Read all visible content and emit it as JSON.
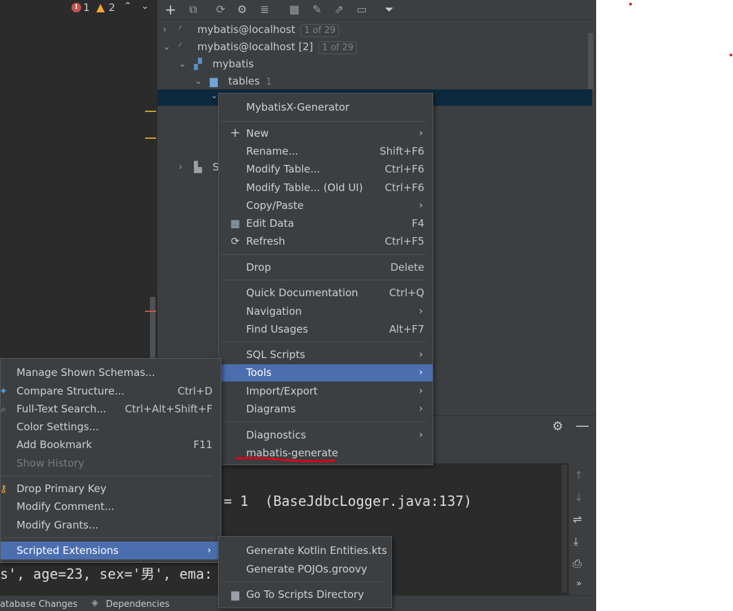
{
  "status": {
    "errors": "1",
    "warnings": "2"
  },
  "tree": {
    "ds1": {
      "label": "mybatis@localhost",
      "badge": "1 of 29"
    },
    "ds2": {
      "label": "mybatis@localhost [2]",
      "badge": "1 of 29"
    },
    "schema": {
      "label": "mybatis"
    },
    "tables": {
      "label": "tables",
      "count": "1"
    },
    "server_label": "S"
  },
  "context_menu": {
    "items": {
      "generator": "MybatisX-Generator",
      "new": "New",
      "rename": "Rename...",
      "rename_sc": "Shift+F6",
      "modify": "Modify Table...",
      "modify_sc": "Ctrl+F6",
      "modify_old": "Modify Table... (Old UI)",
      "modify_old_sc": "Ctrl+F6",
      "copy_paste": "Copy/Paste",
      "edit_data": "Edit Data",
      "edit_data_sc": "F4",
      "refresh": "Refresh",
      "refresh_sc": "Ctrl+F5",
      "drop": "Drop",
      "drop_sc": "Delete",
      "quick_doc": "Quick Documentation",
      "quick_doc_sc": "Ctrl+Q",
      "navigation": "Navigation",
      "find_usages": "Find Usages",
      "find_usages_sc": "Alt+F7",
      "sql_scripts": "SQL Scripts",
      "tools": "Tools",
      "import_export": "Import/Export",
      "diagrams": "Diagrams",
      "diagnostics": "Diagnostics",
      "mabatis": "mabatis-generate"
    }
  },
  "left_menu": {
    "items": {
      "manage_schemas": "Manage Shown Schemas...",
      "compare": "Compare Structure...",
      "compare_sc": "Ctrl+D",
      "full_text": "Full-Text Search...",
      "full_text_sc": "Ctrl+Alt+Shift+F",
      "color": "Color Settings...",
      "bookmark": "Add Bookmark",
      "bookmark_sc": "F11",
      "history": "Show History",
      "drop_pk": "Drop Primary Key",
      "modify_comment": "Modify Comment...",
      "modify_grants": "Modify Grants...",
      "scripted": "Scripted Extensions"
    }
  },
  "scripts_menu": {
    "items": {
      "kotlin": "Generate Kotlin Entities.kts",
      "pojos": "Generate POJOs.groovy",
      "go_dir": "Go To Scripts Directory"
    }
  },
  "console": {
    "line1": "d = 1  (BaseJdbcLogger.java:137)",
    "line2": "s', age=23, sex='男', ema:"
  },
  "bottom_tabs": {
    "db_changes": "atabase Changes",
    "dependencies": "Dependencies"
  },
  "colors": {
    "highlight": "#4b6eaf",
    "tree_selection": "#0d293e",
    "annotation_red": "#e0001b"
  }
}
